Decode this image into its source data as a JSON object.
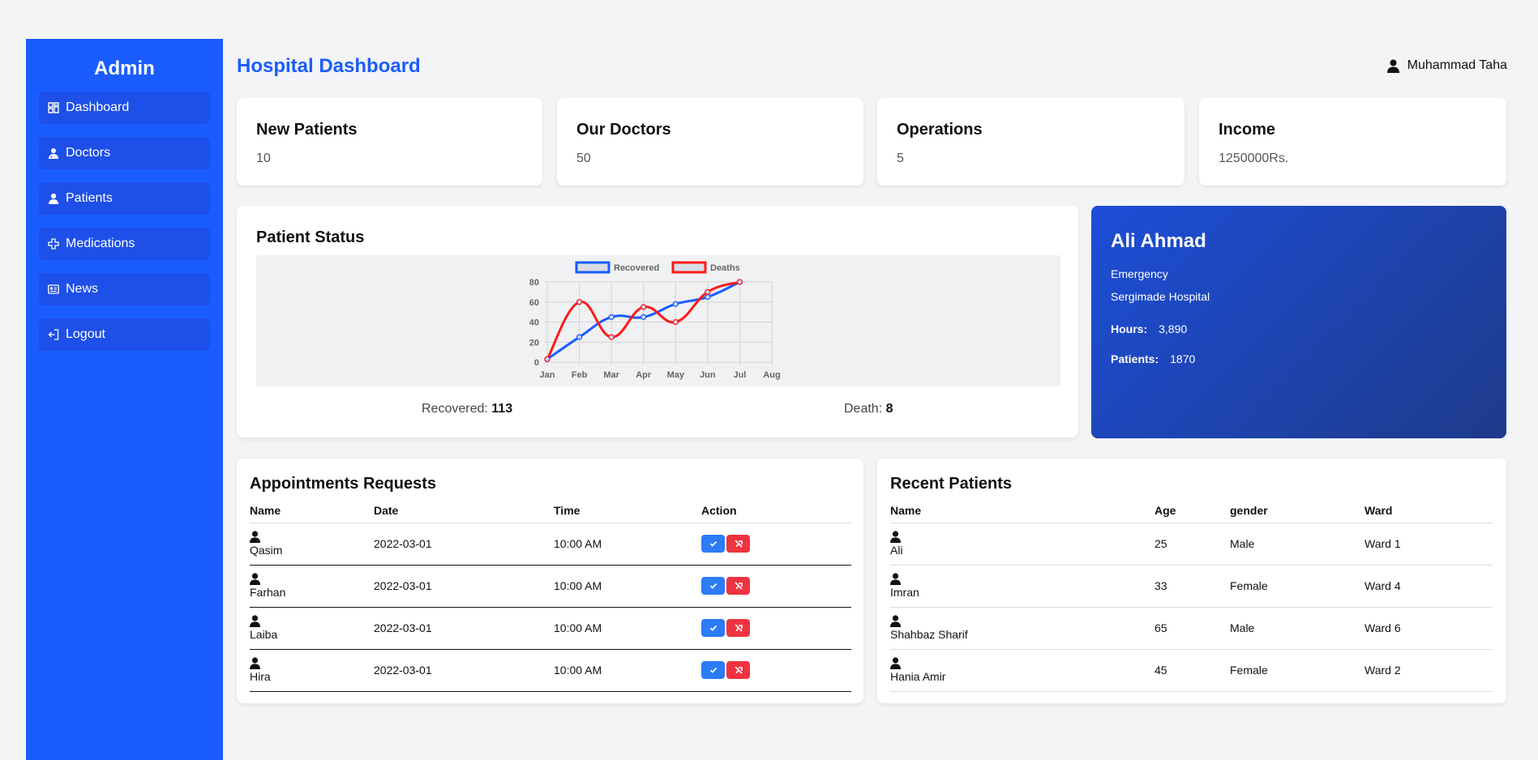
{
  "sidebar": {
    "brand": "Admin",
    "items": [
      {
        "label": "Dashboard"
      },
      {
        "label": "Doctors"
      },
      {
        "label": "Patients"
      },
      {
        "label": "Medications"
      },
      {
        "label": "News"
      },
      {
        "label": "Logout"
      }
    ]
  },
  "header": {
    "title": "Hospital Dashboard",
    "user": "Muhammad Taha"
  },
  "stats": [
    {
      "title": "New Patients",
      "value": "10"
    },
    {
      "title": "Our Doctors",
      "value": "50"
    },
    {
      "title": "Operations",
      "value": "5"
    },
    {
      "title": "Income",
      "value": "1250000Rs."
    }
  ],
  "patient_status": {
    "title": "Patient Status",
    "recovered_label": "Recovered:",
    "recovered_value": "113",
    "death_label": "Death:",
    "death_value": "8"
  },
  "chart_data": {
    "type": "line",
    "categories": [
      "Jan",
      "Feb",
      "Mar",
      "Apr",
      "May",
      "Jun",
      "Jul",
      "Aug"
    ],
    "ylim": [
      0,
      80
    ],
    "yticks": [
      "0",
      "20",
      "40",
      "60",
      "80"
    ],
    "grid": true,
    "legend": "top",
    "series": [
      {
        "name": "Recovered",
        "color": "#1a5cff",
        "values": [
          3,
          25,
          45,
          45,
          58,
          65,
          80
        ]
      },
      {
        "name": "Deaths",
        "color": "#ff1a1a",
        "values": [
          3,
          60,
          25,
          55,
          40,
          70,
          80
        ]
      }
    ]
  },
  "profile": {
    "name": "Ali Ahmad",
    "department": "Emergency",
    "hospital": "Sergimade Hospital",
    "hours_label": "Hours:",
    "hours_value": "3,890",
    "patients_label": "Patients:",
    "patients_value": "1870"
  },
  "appointments": {
    "title": "Appointments Requests",
    "columns": [
      "Name",
      "Date",
      "Time",
      "Action"
    ],
    "rows": [
      {
        "name": "Qasim",
        "date": "2022-03-01",
        "time": "10:00 AM"
      },
      {
        "name": "Farhan",
        "date": "2022-03-01",
        "time": "10:00 AM"
      },
      {
        "name": "Laiba",
        "date": "2022-03-01",
        "time": "10:00 AM"
      },
      {
        "name": "Hira",
        "date": "2022-03-01",
        "time": "10:00 AM"
      }
    ]
  },
  "recent": {
    "title": "Recent Patients",
    "columns": [
      "Name",
      "Age",
      "gender",
      "Ward"
    ],
    "rows": [
      {
        "name": "Ali",
        "age": "25",
        "gender": "Male",
        "ward": "Ward 1"
      },
      {
        "name": "Imran",
        "age": "33",
        "gender": "Female",
        "ward": "Ward 4"
      },
      {
        "name": "Shahbaz Sharif",
        "age": "65",
        "gender": "Male",
        "ward": "Ward 6"
      },
      {
        "name": "Hania Amir",
        "age": "45",
        "gender": "Female",
        "ward": "Ward 2"
      }
    ]
  }
}
